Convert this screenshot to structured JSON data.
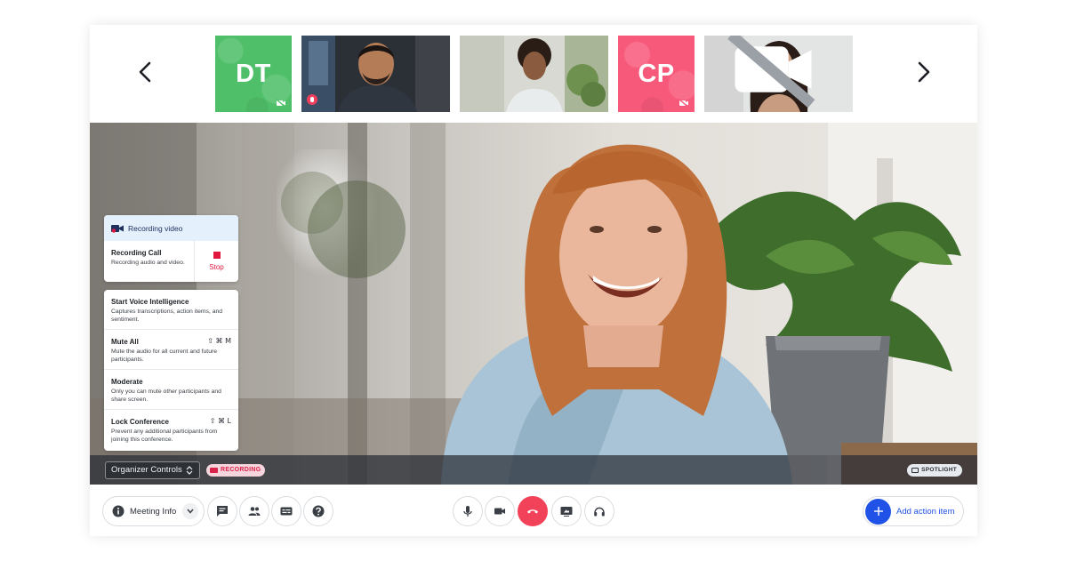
{
  "filmstrip": {
    "participants": [
      {
        "initials": "DT",
        "color": "#4fbf69",
        "video_off_icon": "video-off-icon"
      },
      {
        "kind": "photo",
        "mic_icon": "mic-muted-icon"
      },
      {
        "kind": "photo"
      },
      {
        "initials": "CP",
        "color": "#f7597a",
        "video_off_icon": "video-off-icon"
      },
      {
        "kind": "photo",
        "video_off_icon": "video-off-icon"
      }
    ],
    "prev_icon": "chevron-left-icon",
    "next_icon": "chevron-right-icon"
  },
  "recording_card": {
    "header": "Recording video",
    "title": "Recording Call",
    "description": "Recording audio and video.",
    "stop_label": "Stop"
  },
  "controls_menu": {
    "items": [
      {
        "title": "Start Voice Intelligence",
        "description": "Captures transcriptions, action items, and sentiment.",
        "shortcut": ""
      },
      {
        "title": "Mute All",
        "description": "Mute the audio for all current and future participants.",
        "shortcut": "⇧ ⌘ M"
      },
      {
        "title": "Moderate",
        "description": "Only you can mute other participants and share screen.",
        "shortcut": ""
      },
      {
        "title": "Lock Conference",
        "description": "Prevent any additional participants from joining this conference.",
        "shortcut": "⇧ ⌘ L"
      }
    ]
  },
  "stage_bar": {
    "organizer_controls": "Organizer Controls",
    "recording_badge": "RECORDING",
    "spotlight_badge": "SPOTLIGHT"
  },
  "toolbar": {
    "meeting_info": "Meeting Info",
    "add_action_item": "Add action item",
    "icons": [
      "info-icon",
      "chat-icon",
      "participants-icon",
      "captions-icon",
      "help-icon",
      "mic-icon",
      "camera-icon",
      "end-call-icon",
      "share-screen-icon",
      "headphones-icon",
      "plus-icon"
    ]
  },
  "colors": {
    "accent_blue": "#2052e8",
    "end_call_red": "#f2425a",
    "recording_red": "#e0173e"
  }
}
